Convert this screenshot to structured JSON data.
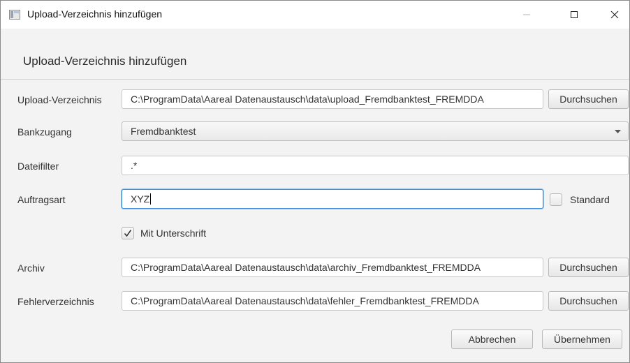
{
  "window": {
    "title": "Upload-Verzeichnis hinzufügen"
  },
  "dialog": {
    "header": "Upload-Verzeichnis hinzufügen"
  },
  "form": {
    "upload_dir": {
      "label": "Upload-Verzeichnis",
      "value": "C:\\ProgramData\\Aareal Datenaustausch\\data\\upload_Fremdbanktest_FREMDDA",
      "browse_label": "Durchsuchen"
    },
    "bank_access": {
      "label": "Bankzugang",
      "selected": "Fremdbanktest"
    },
    "file_filter": {
      "label": "Dateifilter",
      "value": ".*"
    },
    "order_type": {
      "label": "Auftragsart",
      "value": "XYZ",
      "standard_label": "Standard",
      "standard_checked": false
    },
    "signature": {
      "label": "Mit Unterschrift",
      "checked": true
    },
    "archive": {
      "label": "Archiv",
      "value": "C:\\ProgramData\\Aareal Datenaustausch\\data\\archiv_Fremdbanktest_FREMDDA",
      "browse_label": "Durchsuchen"
    },
    "error_dir": {
      "label": "Fehlerverzeichnis",
      "value": "C:\\ProgramData\\Aareal Datenaustausch\\data\\fehler_Fremdbanktest_FREMDDA",
      "browse_label": "Durchsuchen"
    }
  },
  "footer": {
    "cancel_label": "Abbrechen",
    "apply_label": "Übernehmen"
  },
  "icons": {
    "app": "window-app-icon",
    "minimize": "minimize-icon",
    "maximize": "maximize-icon",
    "close": "close-icon",
    "combo": "chevron-down-icon",
    "check": "checkmark-icon"
  },
  "colors": {
    "focus_border": "#3d8fd6",
    "dialog_background": "#f3f3f3"
  }
}
